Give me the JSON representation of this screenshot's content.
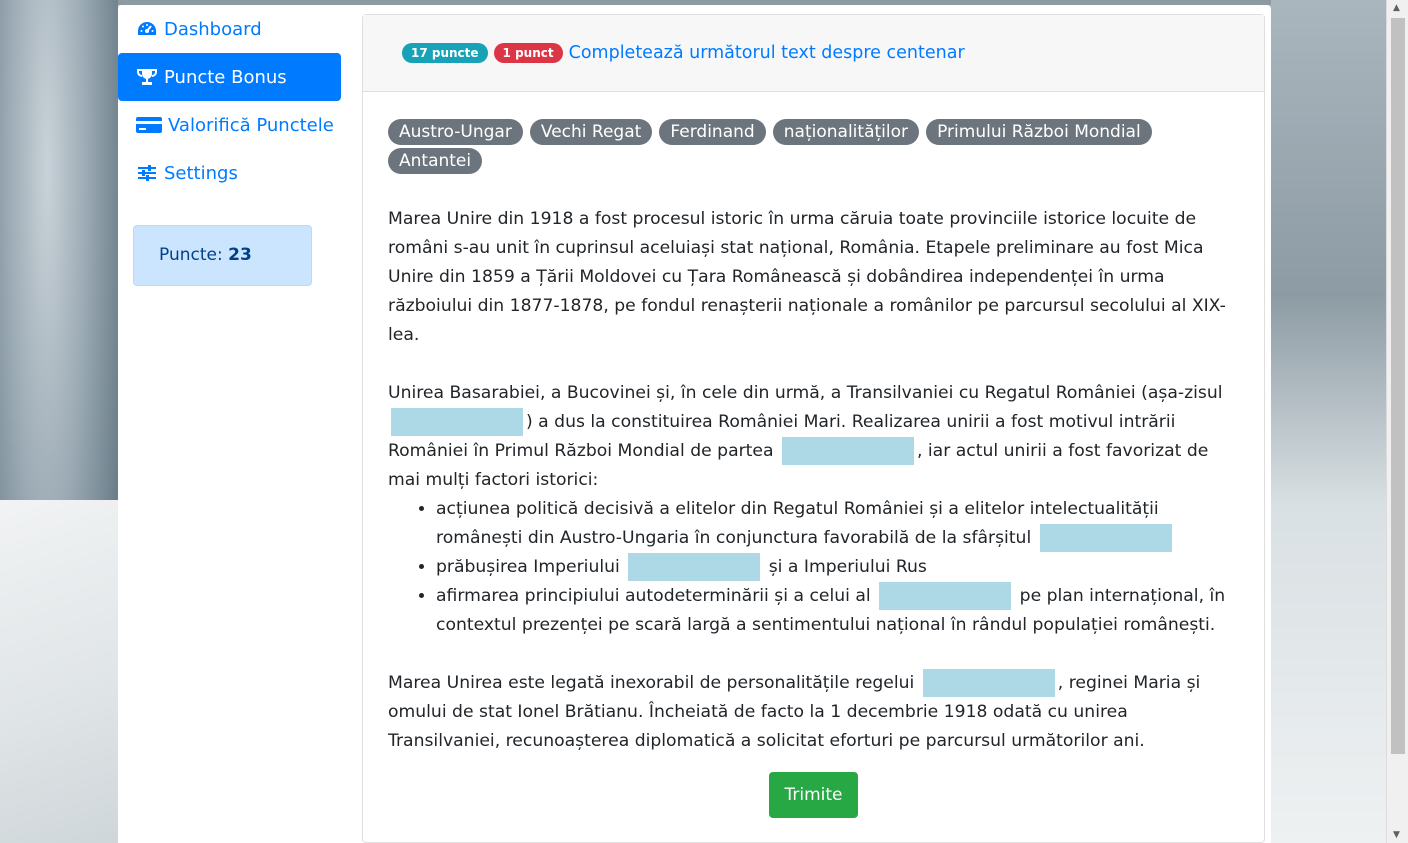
{
  "sidebar": {
    "items": [
      {
        "label": "Dashboard",
        "icon": "tachometer-icon",
        "active": false
      },
      {
        "label": "Puncte Bonus",
        "icon": "trophy-icon",
        "active": true
      },
      {
        "label": "Valorifică Punctele",
        "icon": "credit-card-icon",
        "active": false
      },
      {
        "label": "Settings",
        "icon": "sliders-icon",
        "active": false
      }
    ],
    "points_label": "Puncte:",
    "points_value": "23"
  },
  "card": {
    "badge_points": "17 puncte",
    "badge_penalty": "1 punct",
    "title": "Completează următorul text despre centenar",
    "words": [
      "Austro-Ungar",
      "Vechi Regat",
      "Ferdinand",
      "naționalităților",
      "Primului Război Mondial",
      "Antantei"
    ],
    "p1": "Marea Unire din 1918 a fost procesul istoric în urma căruia toate provinciile istorice locuite de români s-au unit în cuprinsul aceluiași stat național, România. Etapele preliminare au fost Mica Unire din 1859 a Țării Moldovei cu Țara Românească și dobândirea independenței în urma războiului din 1877-1878, pe fondul renașterii naționale a românilor pe parcursul secolului al XIX-lea.",
    "p2_a": "Unirea Basarabiei, a Bucovinei și, în cele din urmă, a Transilvaniei cu Regatul României (așa-zisul",
    "p2_b": ") a dus la constituirea României Mari. Realizarea unirii a fost motivul intrării României în Primul Război Mondial de partea",
    "p2_c": ", iar actul unirii a fost favorizat de mai mulți factori istorici:",
    "li1_a": "acțiunea politică decisivă a elitelor din Regatul României și a elitelor intelectualității românești din Austro-Ungaria în conjunctura favorabilă de la sfârșitul",
    "li2_a": "prăbușirea Imperiului",
    "li2_b": "și a Imperiului Rus",
    "li3_a": "afirmarea principiului autodeterminării și a celui al",
    "li3_b": "pe plan internațional, în contextul prezenței pe scară largă a sentimentului național în rândul populației românești.",
    "p3_a": "Marea Unirea este legată inexorabil de personalitățile regelui",
    "p3_b": ", reginei Maria și omului de stat Ionel Brătianu. Încheiată de facto la 1 decembrie 1918 odată cu unirea Transilvaniei, recunoașterea diplomatică a solicitat eforturi pe parcursul următorilor ani.",
    "submit_label": "Trimite"
  },
  "colors": {
    "primary": "#007bff",
    "info_badge": "#17a2b8",
    "danger_badge": "#dc3545",
    "word_chip": "#6c757d",
    "blank": "#add8e6",
    "submit": "#28a745"
  }
}
